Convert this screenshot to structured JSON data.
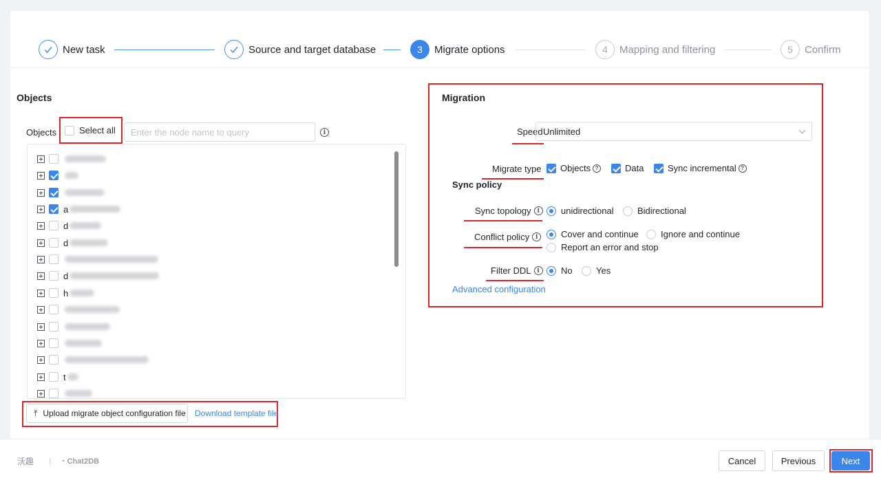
{
  "steps": [
    {
      "label": "New task",
      "number": "1",
      "state": "done"
    },
    {
      "label": "Source and target database",
      "number": "2",
      "state": "done"
    },
    {
      "label": "Migrate options",
      "number": "3",
      "state": "active"
    },
    {
      "label": "Mapping and filtering",
      "number": "4",
      "state": "todo"
    },
    {
      "label": "Confirm",
      "number": "5",
      "state": "todo"
    }
  ],
  "objects": {
    "section_title": "Objects",
    "field_label": "Objects",
    "select_all_label": "Select all",
    "search_placeholder": "Enter the node name to query",
    "tree_items": [
      {
        "name": "",
        "checked": false
      },
      {
        "name": "",
        "checked": true
      },
      {
        "name": "",
        "checked": true
      },
      {
        "name": "a",
        "checked": true
      },
      {
        "name": "d",
        "checked": false
      },
      {
        "name": "d",
        "checked": false
      },
      {
        "name": "",
        "checked": false
      },
      {
        "name": "d",
        "checked": false
      },
      {
        "name": "h",
        "checked": false
      },
      {
        "name": "",
        "checked": false
      },
      {
        "name": "",
        "checked": false
      },
      {
        "name": "",
        "checked": false
      },
      {
        "name": "",
        "checked": false
      },
      {
        "name": "t",
        "checked": false
      },
      {
        "name": "",
        "checked": false
      }
    ],
    "upload_label": "Upload migrate object configuration file",
    "download_label": "Download template file"
  },
  "migration": {
    "title": "Migration",
    "speed_label": "Speed",
    "speed_value": "Unlimited",
    "migrate_type_label": "Migrate type",
    "migrate_types": [
      {
        "label": "Objects",
        "checked": true,
        "help": true
      },
      {
        "label": "Data",
        "checked": true,
        "help": false
      },
      {
        "label": "Sync incremental",
        "checked": true,
        "help": true
      }
    ],
    "sync_policy_title": "Sync policy",
    "sync_topology_label": "Sync topology",
    "sync_topology_options": [
      {
        "label": "unidirectional",
        "selected": true
      },
      {
        "label": "Bidirectional",
        "selected": false
      }
    ],
    "conflict_policy_label": "Conflict policy",
    "conflict_policy_options": [
      {
        "label": "Cover and continue",
        "selected": true
      },
      {
        "label": "Ignore and continue",
        "selected": false
      },
      {
        "label": "Report an error and stop",
        "selected": false
      }
    ],
    "filter_ddl_label": "Filter DDL",
    "filter_ddl_options": [
      {
        "label": "No",
        "selected": true
      },
      {
        "label": "Yes",
        "selected": false
      }
    ],
    "advanced_label": "Advanced configuration"
  },
  "footer": {
    "brand_cn": "沃趣",
    "brand_product": "Chat2DB",
    "cancel_label": "Cancel",
    "previous_label": "Previous",
    "next_label": "Next"
  },
  "colors": {
    "primary": "#3b86ea",
    "highlight": "#d9262c"
  }
}
